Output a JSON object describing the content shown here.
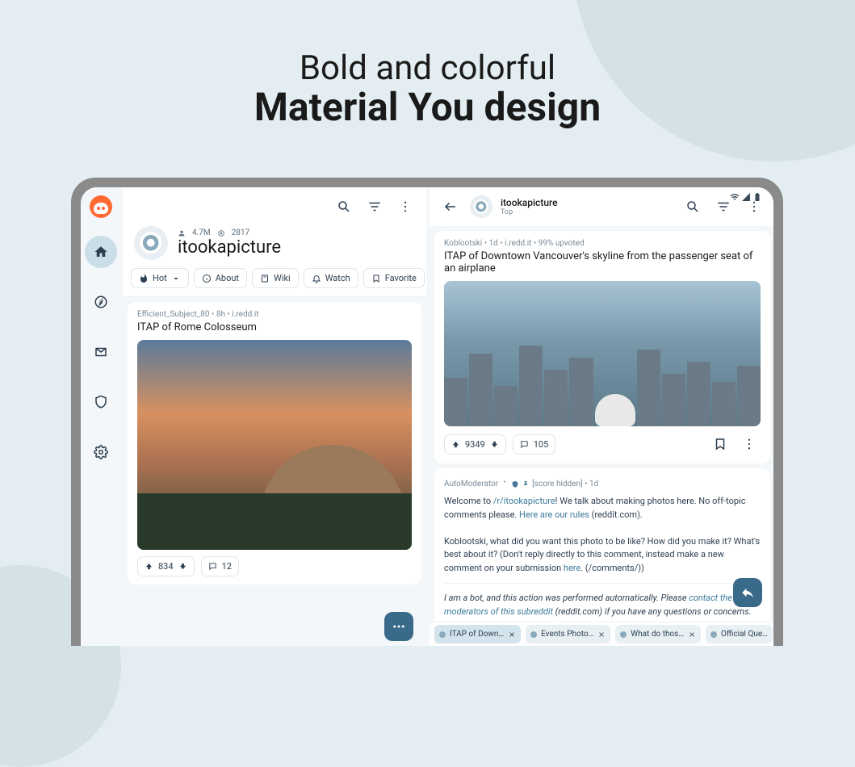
{
  "hero": {
    "line1": "Bold and colorful",
    "line2": "Material You design"
  },
  "sidebar": {
    "items": [
      "home",
      "explore",
      "mail",
      "mod",
      "settings"
    ]
  },
  "left": {
    "subreddit": {
      "members": "4.7M",
      "online": "2817",
      "name": "itookapicture"
    },
    "toolbar": {
      "hot": "Hot",
      "about": "About",
      "wiki": "Wiki",
      "watch": "Watch",
      "favorite": "Favorite"
    },
    "post": {
      "meta": "Efficient_Subject_80 • 8h • i.redd.it",
      "title": "ITAP of Rome Colosseum",
      "votes": "834",
      "comments": "12"
    }
  },
  "right": {
    "header": {
      "name": "itookapicture",
      "sort": "Top"
    },
    "post": {
      "meta": "Koblootski • 1d • i.redd.it • 99% upvoted",
      "title": "ITAP of Downtown Vancouver's skyline from the passenger seat of an airplane",
      "votes": "9349",
      "comments": "105"
    },
    "comment": {
      "author": "AutoModerator",
      "meta_suffix": " [score hidden] • 1d",
      "body1a": "Welcome to ",
      "link1": "/r/itookapicture",
      "body1b": "! We talk about making photos here. No off-topic comments please. ",
      "link2": "Here are our rules",
      "body1c": " (reddit.com).",
      "body2a": "Koblootski, what did you want this photo to be like? How did you make it? What's best about it? (Don't reply directly to this comment, instead make a new comment on your submission ",
      "link3": "here",
      "body2b": ". (/comments/))",
      "footer1": "I am a bot, and this action was performed automatically. Please ",
      "footer_link": "contact the moderators of this subreddit",
      "footer2": " (reddit.com) if you have any questions or concerns."
    },
    "tabs": [
      "ITAP of Down…",
      "Events Photo…",
      "What do thos…",
      "Official Que…"
    ]
  }
}
